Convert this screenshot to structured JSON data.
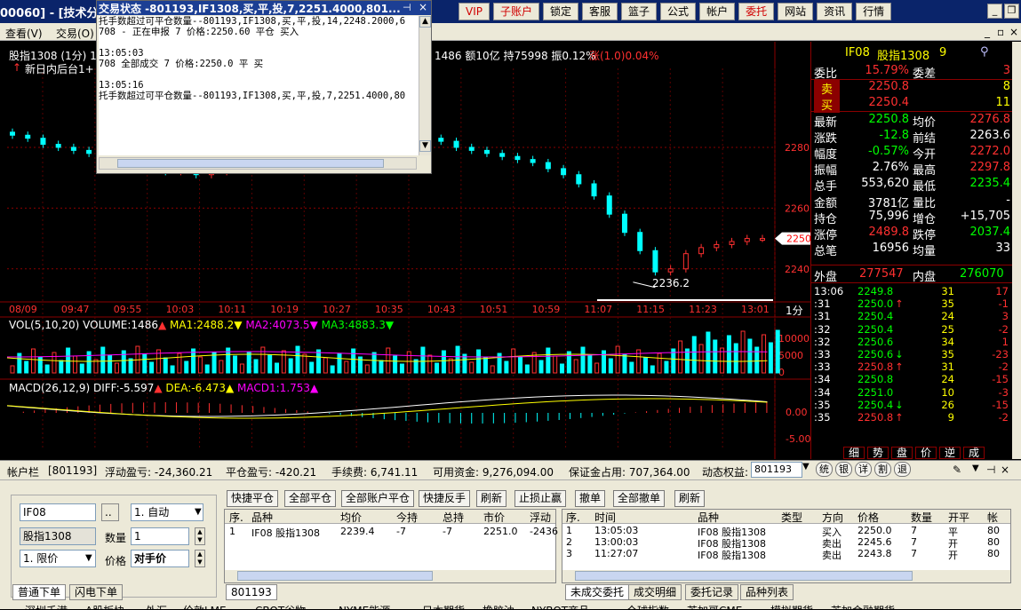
{
  "window": {
    "title_left": "00060] - [技术分析",
    "top_buttons": [
      {
        "label": "VIP",
        "red": true
      },
      {
        "label": "子账户",
        "red": true
      },
      {
        "label": "锁定",
        "red": false
      },
      {
        "label": "客服",
        "red": false
      },
      {
        "label": "篮子",
        "red": false
      },
      {
        "label": "公式",
        "red": false
      },
      {
        "label": "帐户",
        "red": false
      },
      {
        "label": "委托",
        "red": true
      },
      {
        "label": "网站",
        "red": false
      },
      {
        "label": "资讯",
        "red": false
      },
      {
        "label": "行情",
        "red": false
      }
    ]
  },
  "menu": {
    "view": "查看(V)",
    "trade": "交易(O)"
  },
  "chart": {
    "header_left": "股指1308 (1分) 1",
    "header_right": "1486 额10亿 持75998 振0.12%",
    "header_change": "涨(1.0)0.04%",
    "subline": "新日内后台1+",
    "price_labels": [
      "2280",
      "2260",
      "2240"
    ],
    "current_price": "2250",
    "low_label": "2236.2",
    "time_labels": [
      "08/09",
      "09:47",
      "09:55",
      "10:03",
      "10:11",
      "10:19",
      "10:27",
      "10:35",
      "10:43",
      "10:51",
      "10:59",
      "11:07",
      "11:15",
      "11:23",
      "13:01"
    ],
    "period": "1分",
    "vol_title": "VOL(5,10,20)",
    "vol_value": "VOLUME:1486",
    "vol_ma1": "MA1:2488.2",
    "vol_ma2": "MA2:4073.5",
    "vol_ma3": "MA3:4883.3",
    "vol_ticks": [
      "10000",
      "5000",
      "0"
    ],
    "macd_title": "MACD(26,12,9)",
    "macd_diff": "DIFF:-5.597",
    "macd_dea": "DEA:-6.473",
    "macd_macd1": "MACD1:1.753",
    "macd_ticks": [
      "0.00",
      "-5.00"
    ]
  },
  "chart_data": {
    "type": "candlestick",
    "title": "股指1308 (1分)",
    "price_axis": {
      "ticks": [
        2280,
        2260,
        2240
      ],
      "range": [
        2230,
        2306
      ]
    },
    "x_labels": [
      "08/09",
      "09:47",
      "09:55",
      "10:03",
      "10:11",
      "10:19",
      "10:27",
      "10:35",
      "10:43",
      "10:51",
      "10:59",
      "11:07",
      "11:15",
      "11:23",
      "13:01"
    ],
    "close_series": [
      2284,
      2283,
      2281,
      2280,
      2279,
      2278,
      2277,
      2276,
      2275,
      2274,
      2272,
      2272,
      2271,
      2272,
      2273,
      2274,
      2275,
      2276,
      2277,
      2278,
      2278,
      2279,
      2280,
      2280,
      2281,
      2282,
      2283,
      2283,
      2282,
      2280,
      2279,
      2278,
      2277,
      2276,
      2275,
      2273,
      2271,
      2268,
      2264,
      2258,
      2252,
      2246,
      2239,
      2240,
      2245,
      2247,
      2248,
      2249,
      2250,
      2250
    ],
    "low_marker": 2236.2,
    "volume_axis": {
      "ticks": [
        10000,
        5000,
        0
      ]
    }
  },
  "popup": {
    "header": "交易状态 -801193,IF1308,买,平,投,7,2251.4000,801...",
    "lines": [
      "托手数超过可平仓数量--801193,IF1308,买,平,投,14,2248.2000,6",
      "708 - 正在申报 7 价格:2250.60 平仓 买入",
      "",
      "13:05:03",
      "708 全部成交 7 价格:2250.0 平 买",
      "",
      "13:05:16",
      "托手数超过可平仓数量--801193,IF1308,买,平,投,7,2251.4000,80"
    ],
    "time1": "13:05:03"
  },
  "quote": {
    "code": "IF08",
    "name": "股指1308",
    "num": "9",
    "rows": [
      {
        "l": "委比",
        "v": "15.79%",
        "vc": "#ff3030",
        "l2": "委差",
        "v2": "3",
        "v2c": "#ff3030"
      },
      {
        "l": "卖",
        "v": "2250.8",
        "vc": "#ff3030",
        "l2": "",
        "v2": "8",
        "v2c": "#ffff00"
      },
      {
        "l": "买",
        "v": "2250.4",
        "vc": "#ff3030",
        "l2": "",
        "v2": "11",
        "v2c": "#ffff00"
      },
      {
        "l": "最新",
        "v": "2250.8",
        "vc": "#00ff00",
        "l2": "均价",
        "v2": "2276.8",
        "v2c": "#ff3030"
      },
      {
        "l": "涨跌",
        "v": "-12.8",
        "vc": "#00ff00",
        "l2": "前结",
        "v2": "2263.6",
        "v2c": "#ffffff"
      },
      {
        "l": "幅度",
        "v": "-0.57%",
        "vc": "#00ff00",
        "l2": "今开",
        "v2": "2272.0",
        "v2c": "#ff3030"
      },
      {
        "l": "振幅",
        "v": "2.76%",
        "vc": "#ffffff",
        "l2": "最高",
        "v2": "2297.8",
        "v2c": "#ff3030"
      },
      {
        "l": "总手",
        "v": "553,620",
        "vc": "#ffffff",
        "l2": "最低",
        "v2": "2235.4",
        "v2c": "#00ff00"
      },
      {
        "l": "金额",
        "v": "3781亿",
        "vc": "#ffffff",
        "l2": "量比",
        "v2": "-",
        "v2c": "#ffffff"
      },
      {
        "l": "持仓",
        "v": "75,996",
        "vc": "#ffffff",
        "l2": "增仓",
        "v2": "+15,705",
        "v2c": "#ffffff"
      },
      {
        "l": "涨停",
        "v": "2489.8",
        "vc": "#ff3030",
        "l2": "跌停",
        "v2": "2037.4",
        "v2c": "#00ff00"
      },
      {
        "l": "总笔",
        "v": "16956",
        "vc": "#ffffff",
        "l2": "均量",
        "v2": "33",
        "v2c": "#ffffff"
      }
    ],
    "outer_label": "外盘",
    "outer": "277547",
    "inner_label": "内盘",
    "inner": "276070",
    "ticks": [
      {
        "t": "13:06",
        "p": "2249.8",
        "pc": "#00ff00",
        "a": "",
        "v": "31",
        "d": "17"
      },
      {
        "t": ":31",
        "p": "2250.0",
        "pc": "#00ff00",
        "a": "↑",
        "v": "35",
        "d": "-1"
      },
      {
        "t": ":31",
        "p": "2250.4",
        "pc": "#00ff00",
        "a": "",
        "v": "24",
        "d": "3"
      },
      {
        "t": ":32",
        "p": "2250.4",
        "pc": "#00ff00",
        "a": "",
        "v": "25",
        "d": "-2"
      },
      {
        "t": ":32",
        "p": "2250.6",
        "pc": "#00ff00",
        "a": "",
        "v": "34",
        "d": "1"
      },
      {
        "t": ":33",
        "p": "2250.6",
        "pc": "#00ff00",
        "a": "↓",
        "v": "35",
        "d": "-23"
      },
      {
        "t": ":33",
        "p": "2250.8",
        "pc": "#ff3030",
        "a": "↑",
        "v": "31",
        "d": "-2"
      },
      {
        "t": ":34",
        "p": "2250.8",
        "pc": "#00ff00",
        "a": "",
        "v": "24",
        "d": "-15"
      },
      {
        "t": ":34",
        "p": "2251.0",
        "pc": "#00ff00",
        "a": "",
        "v": "10",
        "d": "-3"
      },
      {
        "t": ":35",
        "p": "2250.4",
        "pc": "#00ff00",
        "a": "↓",
        "v": "26",
        "d": "-15"
      },
      {
        "t": ":35",
        "p": "2250.8",
        "pc": "#ff3030",
        "a": "↑",
        "v": "9",
        "d": "-2"
      }
    ],
    "tabs": [
      "细",
      "势",
      "盘",
      "价",
      "逆",
      "成"
    ]
  },
  "account": {
    "label": "帐户栏",
    "id": "[801193]",
    "float_pl": "浮动盈亏: -24,360.21",
    "close_pl": "平仓盈亏: -420.21",
    "fee": "手续费: 6,741.11",
    "avail": "可用资金: 9,276,094.00",
    "margin": "保证金占用: 707,364.00",
    "equity_label": "动态权益:",
    "equity_sel": "801193",
    "buttons": [
      "统",
      "银",
      "详",
      "割",
      "退"
    ]
  },
  "order": {
    "code": "IF08",
    "name": "股指1308",
    "mode": "1. 自动",
    "qty_label": "数量",
    "qty": "1",
    "price_type": "1. 限价",
    "price_label": "价格",
    "price": "对手价",
    "dots": "..",
    "tabs": [
      "普通下单",
      "闪电下单"
    ]
  },
  "pos_buttons": [
    "快捷平仓",
    "全部平仓",
    "全部账户平仓",
    "快捷反手",
    "刷新",
    "止损止赢",
    "撤单",
    "全部撤单",
    "刷新"
  ],
  "positions": {
    "headers": [
      "序.",
      "品种",
      "均价",
      "今持",
      "总持",
      "市价",
      "浮动"
    ],
    "rows": [
      [
        "1",
        "IF08 股指1308",
        "2239.4",
        "-7",
        "-7",
        "2251.0",
        "-2436"
      ]
    ],
    "footer": "801193"
  },
  "orders": {
    "headers": [
      "序.",
      "时间",
      "品种",
      "类型",
      "方向",
      "价格",
      "数量",
      "开平",
      "帐"
    ],
    "rows": [
      [
        "1",
        "13:05:03",
        "IF08 股指1308",
        "",
        "买入",
        "2250.0",
        "7",
        "平",
        "80"
      ],
      [
        "2",
        "13:00:03",
        "IF08 股指1308",
        "",
        "卖出",
        "2245.6",
        "7",
        "开",
        "80"
      ],
      [
        "3",
        "11:27:07",
        "IF08 股指1308",
        "",
        "卖出",
        "2243.8",
        "7",
        "开",
        "80"
      ]
    ],
    "tabs": [
      "未成交委托",
      "成交明细",
      "委托记录",
      "品种列表"
    ]
  },
  "bottom": [
    "深圳千港",
    "A股板块",
    "外汇",
    "伦敦LME",
    "CBOT谷物",
    "NYME能源",
    "日本期货",
    "橡胶油",
    "NYBOT商品",
    "全球指数",
    "芝加哥CME",
    "模拟期货",
    "芝加金融期货"
  ]
}
